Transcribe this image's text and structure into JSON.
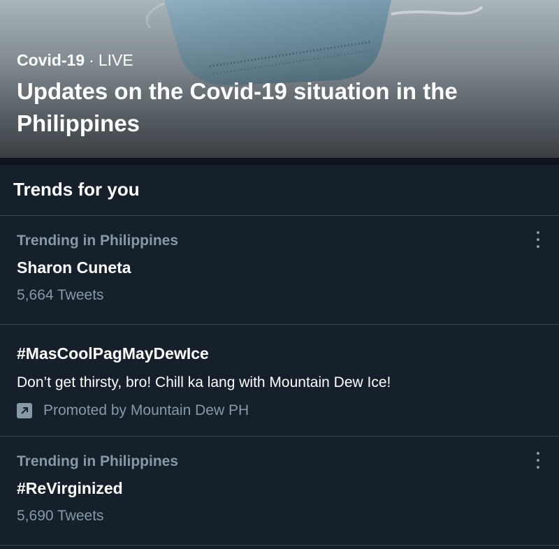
{
  "hero": {
    "category": "Covid-19",
    "separator": "·",
    "status": "LIVE",
    "title": "Updates on the Covid-19 situation in the Philippines"
  },
  "section": {
    "title": "Trends for you"
  },
  "trends": [
    {
      "context": "Trending in Philippines",
      "name": "Sharon Cuneta",
      "count": "5,664 Tweets"
    },
    {
      "name": "#MasCoolPagMayDewIce",
      "description": "Don’t get thirsty, bro! Chill ka lang with Mountain Dew Ice!",
      "promoted_by": "Promoted by Mountain Dew PH",
      "promo_icon": "promoted-arrow-icon"
    },
    {
      "context": "Trending in Philippines",
      "name": "#ReVirginized",
      "count": "5,690 Tweets"
    }
  ],
  "icons": {
    "more": "more-vertical-icon"
  },
  "colors": {
    "background": "#15202b",
    "divider": "#38444d",
    "secondary_text": "#8899a6",
    "primary_text": "#ffffff"
  }
}
